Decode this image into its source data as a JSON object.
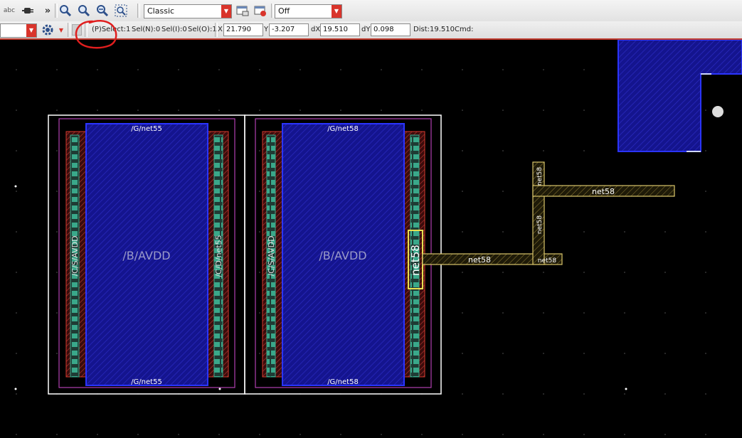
{
  "toolbar1": {
    "abc_label": "abc",
    "more_label": "»",
    "view_mode": "Classic",
    "filter_value": "Off"
  },
  "toolbar2": {
    "select_status": "(P)Select:1",
    "sel_n": "Sel(N):0",
    "sel_i": "Sel(I):0",
    "sel_o": "Sel(O):1",
    "x_label": "X",
    "x_value": "21.790",
    "y_label": "Y",
    "y_value": "-3.207",
    "dx_label": "dX",
    "dx_value": "19.510",
    "dy_label": "dY",
    "dy_value": "0.098",
    "dist": "Dist:19.510",
    "cmd": "Cmd:"
  },
  "layout": {
    "cell1_net_top": "/G/net55",
    "cell1_net_bottom": "/G/net55",
    "cell1_body": "/B/AVDD",
    "cell1_left_pin": "/C/S/AVDD",
    "cell1_right_pin": "/C/D/net55",
    "cell2_net_top": "/G/net58",
    "cell2_net_bottom": "/G/net58",
    "cell2_body": "/B/AVDD",
    "cell2_left_pin": "/C/S/AVDD",
    "cell2_right_pin": "net58",
    "wire_label_main": "net58",
    "wire_label_end": "net58",
    "wire_label_top": "net58",
    "wire_label_vert1": "net58",
    "wire_label_vert2": "net58"
  },
  "colors": {
    "background": "#000000",
    "poly_blue": "#1a1aa8",
    "metal_yellow": "#d8c46a",
    "diff_red": "#c0392b",
    "contact_green": "#3aa88a",
    "annotation_red": "#e01e1e"
  }
}
